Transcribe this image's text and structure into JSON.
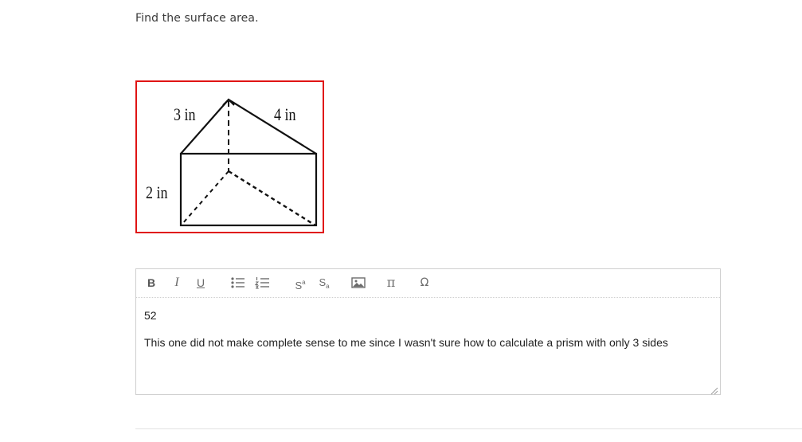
{
  "question": {
    "text": "Find the surface area."
  },
  "figure": {
    "labels": {
      "slant_left": "3 in",
      "slant_right": "4 in",
      "height": "2 in"
    },
    "border_color": "#e01414"
  },
  "editor": {
    "toolbar": {
      "bold": "B",
      "italic": "I",
      "underline": "U",
      "superscript_base": "S",
      "superscript_mark": "a",
      "subscript_base": "S",
      "subscript_mark": "a",
      "pi": "π",
      "omega": "Ω",
      "icons": [
        "bulleted-list-icon",
        "numbered-list-icon",
        "image-icon",
        "resize-handle-icon"
      ]
    },
    "answer": "52",
    "comment": "This one did not make complete sense to me since I wasn't sure how to calculate a prism with only 3 sides"
  }
}
